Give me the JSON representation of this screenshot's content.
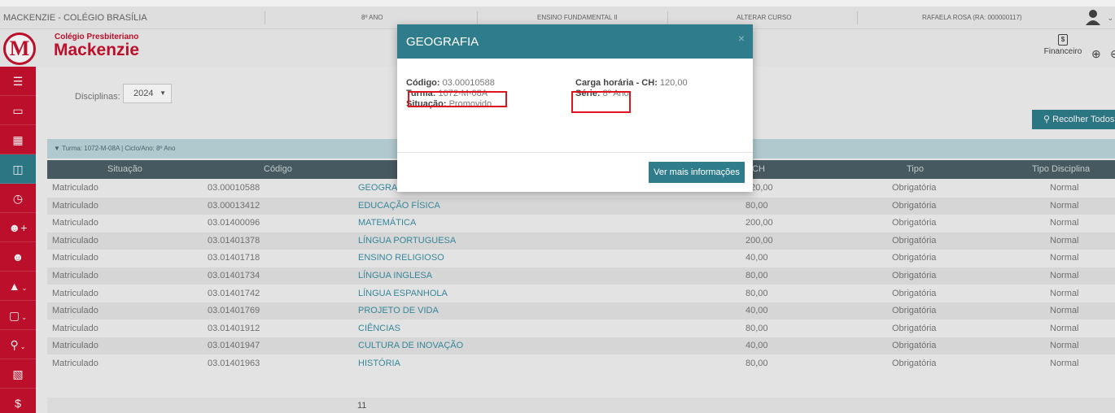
{
  "topbar": {
    "school": "MACKENZIE - COLÉGIO BRASÍLIA",
    "grade": "8º ANO",
    "level": "ENSINO FUNDAMENTAL II",
    "change_course": "ALTERAR CURSO",
    "student": "RAFAELA ROSA (RA: 000000117)"
  },
  "logo": {
    "small": "Colégio Presbiteriano",
    "big": "Mackenzie",
    "letter": "M"
  },
  "header": {
    "financeiro": "Financeiro"
  },
  "filters": {
    "label": "Disciplinas:",
    "year": "2024"
  },
  "buttons": {
    "recolher": "Recolher Todos",
    "ver_mais": "Ver mais informações"
  },
  "turma_bar": "Turma: 1072-M-08A | Ciclo/Ano: 8º Ano",
  "table": {
    "headers": [
      "Situação",
      "Código",
      "CH",
      "Tipo",
      "Tipo Disciplina"
    ],
    "rows": [
      {
        "situacao": "Matriculado",
        "codigo": "03.00010588",
        "disciplina": "GEOGRAFIA",
        "ch": "120,00",
        "tipo": "Obrigatória",
        "tipo_disc": "Normal"
      },
      {
        "situacao": "Matriculado",
        "codigo": "03.00013412",
        "disciplina": "EDUCAÇÃO FÍSICA",
        "ch": "80,00",
        "tipo": "Obrigatória",
        "tipo_disc": "Normal"
      },
      {
        "situacao": "Matriculado",
        "codigo": "03.01400096",
        "disciplina": "MATEMÁTICA",
        "ch": "200,00",
        "tipo": "Obrigatória",
        "tipo_disc": "Normal"
      },
      {
        "situacao": "Matriculado",
        "codigo": "03.01401378",
        "disciplina": "LÍNGUA PORTUGUESA",
        "ch": "200,00",
        "tipo": "Obrigatória",
        "tipo_disc": "Normal"
      },
      {
        "situacao": "Matriculado",
        "codigo": "03.01401718",
        "disciplina": "ENSINO RELIGIOSO",
        "ch": "40,00",
        "tipo": "Obrigatória",
        "tipo_disc": "Normal"
      },
      {
        "situacao": "Matriculado",
        "codigo": "03.01401734",
        "disciplina": "LÍNGUA INGLESA",
        "ch": "80,00",
        "tipo": "Obrigatória",
        "tipo_disc": "Normal"
      },
      {
        "situacao": "Matriculado",
        "codigo": "03.01401742",
        "disciplina": "LÍNGUA ESPANHOLA",
        "ch": "80,00",
        "tipo": "Obrigatória",
        "tipo_disc": "Normal"
      },
      {
        "situacao": "Matriculado",
        "codigo": "03.01401769",
        "disciplina": "PROJETO DE VIDA",
        "ch": "40,00",
        "tipo": "Obrigatória",
        "tipo_disc": "Normal"
      },
      {
        "situacao": "Matriculado",
        "codigo": "03.01401912",
        "disciplina": "CIÊNCIAS",
        "ch": "80,00",
        "tipo": "Obrigatória",
        "tipo_disc": "Normal"
      },
      {
        "situacao": "Matriculado",
        "codigo": "03.01401947",
        "disciplina": "CULTURA DE INOVAÇÃO",
        "ch": "40,00",
        "tipo": "Obrigatória",
        "tipo_disc": "Normal"
      },
      {
        "situacao": "Matriculado",
        "codigo": "03.01401963",
        "disciplina": "HISTÓRIA",
        "ch": "80,00",
        "tipo": "Obrigatória",
        "tipo_disc": "Normal"
      }
    ],
    "footer_count": "11"
  },
  "modal": {
    "title": "GEOGRAFIA",
    "close": "×",
    "codigo_label": "Código:",
    "codigo_value": "03.00010588",
    "turma_label": "Turma:",
    "turma_value": "1072-M-08A",
    "situacao_label": "Situação:",
    "situacao_value": "Promovido",
    "ch_label": "Carga horária - CH:",
    "ch_value": "120,00",
    "serie_label": "Série:",
    "serie_value": "8º Ano"
  },
  "sidebar_icons": [
    "menu-icon",
    "monitor-icon",
    "calendar-icon",
    "clipboard-icon",
    "clock-icon",
    "add-user-icon",
    "user-check-icon",
    "graduation-cap-icon",
    "document-icon",
    "lightbulb-icon",
    "finance-doc-icon",
    "dollar-icon"
  ],
  "colors": {
    "brand_red": "#c8102e",
    "teal": "#2f7d8c",
    "highlight_red": "#e0141e"
  }
}
